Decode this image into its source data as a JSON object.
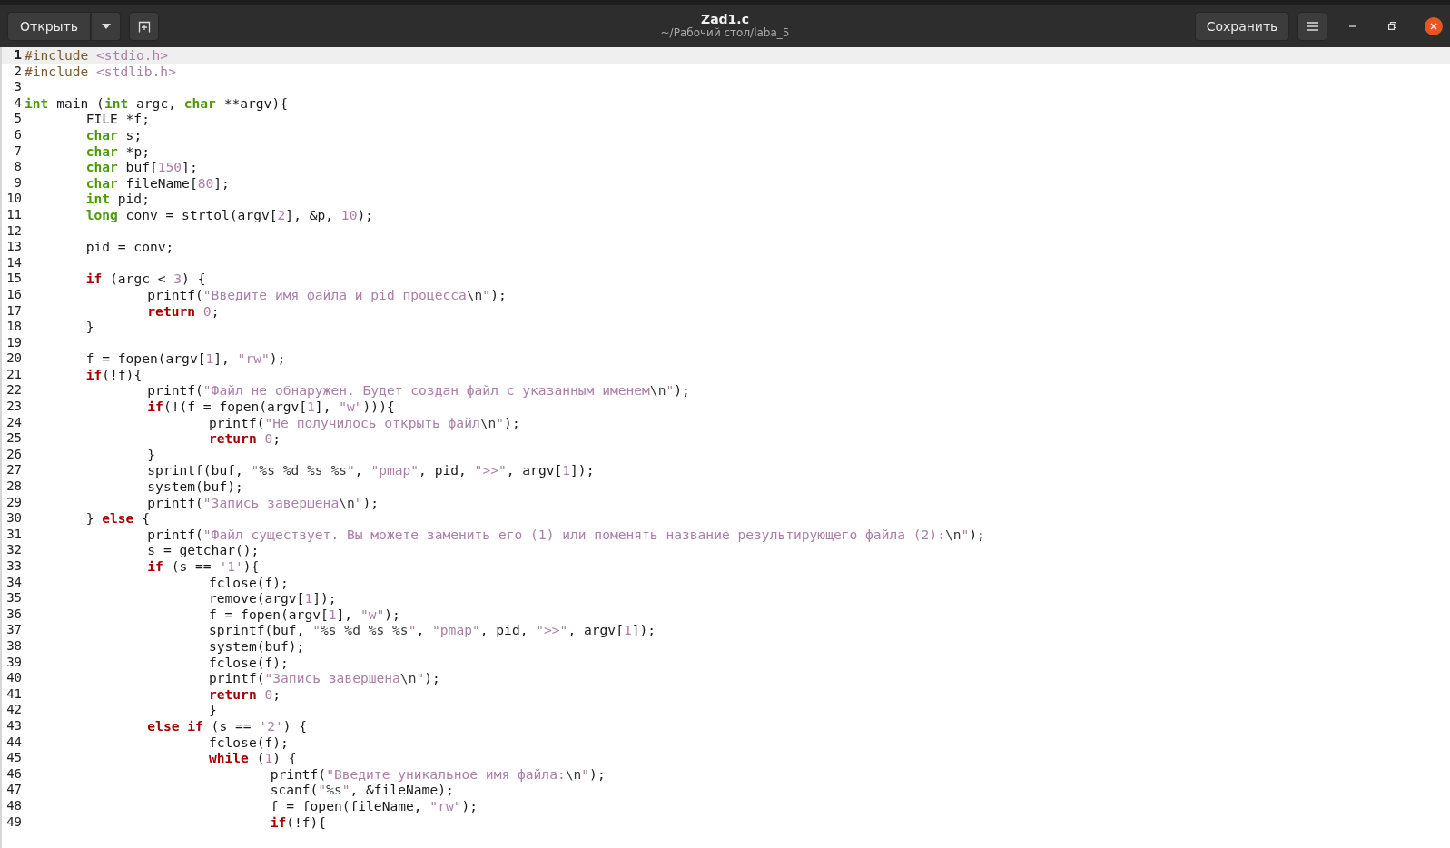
{
  "window": {
    "title": "Zad1.c",
    "subtitle": "~/Рабочий стол/laba_5"
  },
  "header": {
    "open_button": "Открыть",
    "save_button": "Сохранить"
  },
  "lines": [
    {
      "number": "1",
      "current": true,
      "tokens": [
        {
          "kind": "directive",
          "text": "#include "
        },
        {
          "kind": "string",
          "text": "<stdio.h>"
        }
      ]
    },
    {
      "number": "2",
      "current": false,
      "tokens": [
        {
          "kind": "directive",
          "text": "#include "
        },
        {
          "kind": "string",
          "text": "<stdlib.h>"
        }
      ]
    },
    {
      "number": "3",
      "current": false
    },
    {
      "number": "4",
      "current": false,
      "tokens": [
        {
          "kind": "type",
          "text": "int"
        },
        {
          "kind": "plain",
          "text": " main ("
        },
        {
          "kind": "type",
          "text": "int"
        },
        {
          "kind": "plain",
          "text": " argc, "
        },
        {
          "kind": "type",
          "text": "char"
        },
        {
          "kind": "plain",
          "text": " **argv){"
        }
      ]
    },
    {
      "number": "5",
      "current": false,
      "tokens": [
        {
          "kind": "plain",
          "text": "\tFILE *f;"
        }
      ]
    },
    {
      "number": "6",
      "current": false,
      "tokens": [
        {
          "kind": "type",
          "text": "\tchar"
        },
        {
          "kind": "plain",
          "text": " s;"
        }
      ]
    },
    {
      "number": "7",
      "current": false,
      "tokens": [
        {
          "kind": "type",
          "text": "\tchar"
        },
        {
          "kind": "plain",
          "text": " *p;"
        }
      ]
    },
    {
      "number": "8",
      "current": false,
      "tokens": [
        {
          "kind": "type",
          "text": "\tchar"
        },
        {
          "kind": "plain",
          "text": " buf["
        },
        {
          "kind": "number",
          "text": "150"
        },
        {
          "kind": "plain",
          "text": "];"
        }
      ]
    },
    {
      "number": "9",
      "current": false,
      "tokens": [
        {
          "kind": "type",
          "text": "\tchar"
        },
        {
          "kind": "plain",
          "text": " fileName["
        },
        {
          "kind": "number",
          "text": "80"
        },
        {
          "kind": "plain",
          "text": "];"
        }
      ]
    },
    {
      "number": "10",
      "current": false,
      "tokens": [
        {
          "kind": "type",
          "text": "\tint"
        },
        {
          "kind": "plain",
          "text": " pid;"
        }
      ]
    },
    {
      "number": "11",
      "current": false,
      "tokens": [
        {
          "kind": "type",
          "text": "\tlong"
        },
        {
          "kind": "plain",
          "text": " conv = strtol(argv["
        },
        {
          "kind": "number",
          "text": "2"
        },
        {
          "kind": "plain",
          "text": "], &p, "
        },
        {
          "kind": "number",
          "text": "10"
        },
        {
          "kind": "plain",
          "text": ");"
        }
      ]
    },
    {
      "number": "12",
      "current": false
    },
    {
      "number": "13",
      "current": false,
      "tokens": [
        {
          "kind": "plain",
          "text": "\tpid = conv;"
        }
      ]
    },
    {
      "number": "14",
      "current": false
    },
    {
      "number": "15",
      "current": false,
      "tokens": [
        {
          "kind": "keyword",
          "text": "\tif"
        },
        {
          "kind": "plain",
          "text": " (argc < "
        },
        {
          "kind": "number",
          "text": "3"
        },
        {
          "kind": "plain",
          "text": ") {"
        }
      ]
    },
    {
      "number": "16",
      "current": false,
      "tokens": [
        {
          "kind": "plain",
          "text": "\t\tprintf("
        },
        {
          "kind": "string",
          "text": "\"Введите имя файла и pid процесса"
        },
        {
          "kind": "escape",
          "text": "\\n"
        },
        {
          "kind": "string",
          "text": "\""
        },
        {
          "kind": "plain",
          "text": ");"
        }
      ]
    },
    {
      "number": "17",
      "current": false,
      "tokens": [
        {
          "kind": "keyword",
          "text": "\t\treturn "
        },
        {
          "kind": "number",
          "text": "0"
        },
        {
          "kind": "plain",
          "text": ";"
        }
      ]
    },
    {
      "number": "18",
      "current": false,
      "tokens": [
        {
          "kind": "plain",
          "text": "\t}"
        }
      ]
    },
    {
      "number": "19",
      "current": false
    },
    {
      "number": "20",
      "current": false,
      "tokens": [
        {
          "kind": "plain",
          "text": "\tf = fopen(argv["
        },
        {
          "kind": "number",
          "text": "1"
        },
        {
          "kind": "plain",
          "text": "], "
        },
        {
          "kind": "string",
          "text": "\"rw\""
        },
        {
          "kind": "plain",
          "text": ");"
        }
      ]
    },
    {
      "number": "21",
      "current": false,
      "tokens": [
        {
          "kind": "keyword",
          "text": "\tif"
        },
        {
          "kind": "plain",
          "text": "(!f){"
        }
      ]
    },
    {
      "number": "22",
      "current": false,
      "tokens": [
        {
          "kind": "plain",
          "text": "\t\tprintf("
        },
        {
          "kind": "string",
          "text": "\"Файл не обнаружен. Будет создан файл с указанным именем"
        },
        {
          "kind": "escape",
          "text": "\\n"
        },
        {
          "kind": "string",
          "text": "\""
        },
        {
          "kind": "plain",
          "text": ");"
        }
      ]
    },
    {
      "number": "23",
      "current": false,
      "tokens": [
        {
          "kind": "keyword",
          "text": "\t\tif"
        },
        {
          "kind": "plain",
          "text": "(!(f = fopen(argv["
        },
        {
          "kind": "number",
          "text": "1"
        },
        {
          "kind": "plain",
          "text": "], "
        },
        {
          "kind": "string",
          "text": "\"w\""
        },
        {
          "kind": "plain",
          "text": "))){"
        }
      ]
    },
    {
      "number": "24",
      "current": false,
      "tokens": [
        {
          "kind": "plain",
          "text": "\t\t\tprintf("
        },
        {
          "kind": "string",
          "text": "\"Не получилось открыть файл"
        },
        {
          "kind": "escape",
          "text": "\\n"
        },
        {
          "kind": "string",
          "text": "\""
        },
        {
          "kind": "plain",
          "text": ");"
        }
      ]
    },
    {
      "number": "25",
      "current": false,
      "tokens": [
        {
          "kind": "keyword",
          "text": "\t\t\treturn "
        },
        {
          "kind": "number",
          "text": "0"
        },
        {
          "kind": "plain",
          "text": ";"
        }
      ]
    },
    {
      "number": "26",
      "current": false,
      "tokens": [
        {
          "kind": "plain",
          "text": "\t\t}"
        }
      ]
    },
    {
      "number": "27",
      "current": false,
      "tokens": [
        {
          "kind": "plain",
          "text": "\t\tsprintf(buf, "
        },
        {
          "kind": "string",
          "text": "\""
        },
        {
          "kind": "escape",
          "text": "%s %d %s %s"
        },
        {
          "kind": "string",
          "text": "\""
        },
        {
          "kind": "plain",
          "text": ", "
        },
        {
          "kind": "string",
          "text": "\"pmap\""
        },
        {
          "kind": "plain",
          "text": ", pid, "
        },
        {
          "kind": "string",
          "text": "\">>\""
        },
        {
          "kind": "plain",
          "text": ", argv["
        },
        {
          "kind": "number",
          "text": "1"
        },
        {
          "kind": "plain",
          "text": "]);"
        }
      ]
    },
    {
      "number": "28",
      "current": false,
      "tokens": [
        {
          "kind": "plain",
          "text": "\t\tsystem(buf);"
        }
      ]
    },
    {
      "number": "29",
      "current": false,
      "tokens": [
        {
          "kind": "plain",
          "text": "\t\tprintf("
        },
        {
          "kind": "string",
          "text": "\"Запись завершена"
        },
        {
          "kind": "escape",
          "text": "\\n"
        },
        {
          "kind": "string",
          "text": "\""
        },
        {
          "kind": "plain",
          "text": ");"
        }
      ]
    },
    {
      "number": "30",
      "current": false,
      "tokens": [
        {
          "kind": "plain",
          "text": "\t} "
        },
        {
          "kind": "keyword",
          "text": "else"
        },
        {
          "kind": "plain",
          "text": " {"
        }
      ]
    },
    {
      "number": "31",
      "current": false,
      "tokens": [
        {
          "kind": "plain",
          "text": "\t\tprintf("
        },
        {
          "kind": "string",
          "text": "\"Файл существует. Вы можете заменить его (1) или поменять название результирующего файла (2):"
        },
        {
          "kind": "escape",
          "text": "\\n"
        },
        {
          "kind": "string",
          "text": "\""
        },
        {
          "kind": "plain",
          "text": ");"
        }
      ]
    },
    {
      "number": "32",
      "current": false,
      "tokens": [
        {
          "kind": "plain",
          "text": "\t\ts = getchar();"
        }
      ]
    },
    {
      "number": "33",
      "current": false,
      "tokens": [
        {
          "kind": "keyword",
          "text": "\t\tif"
        },
        {
          "kind": "plain",
          "text": " (s == "
        },
        {
          "kind": "string",
          "text": "'1'"
        },
        {
          "kind": "plain",
          "text": "){"
        }
      ]
    },
    {
      "number": "34",
      "current": false,
      "tokens": [
        {
          "kind": "plain",
          "text": "\t\t\tfclose(f);"
        }
      ]
    },
    {
      "number": "35",
      "current": false,
      "tokens": [
        {
          "kind": "plain",
          "text": "\t\t\tremove(argv["
        },
        {
          "kind": "number",
          "text": "1"
        },
        {
          "kind": "plain",
          "text": "]);"
        }
      ]
    },
    {
      "number": "36",
      "current": false,
      "tokens": [
        {
          "kind": "plain",
          "text": "\t\t\tf = fopen(argv["
        },
        {
          "kind": "number",
          "text": "1"
        },
        {
          "kind": "plain",
          "text": "], "
        },
        {
          "kind": "string",
          "text": "\"w\""
        },
        {
          "kind": "plain",
          "text": ");"
        }
      ]
    },
    {
      "number": "37",
      "current": false,
      "tokens": [
        {
          "kind": "plain",
          "text": "\t\t\tsprintf(buf, "
        },
        {
          "kind": "string",
          "text": "\""
        },
        {
          "kind": "escape",
          "text": "%s %d %s %s"
        },
        {
          "kind": "string",
          "text": "\""
        },
        {
          "kind": "plain",
          "text": ", "
        },
        {
          "kind": "string",
          "text": "\"pmap\""
        },
        {
          "kind": "plain",
          "text": ", pid, "
        },
        {
          "kind": "string",
          "text": "\">>\""
        },
        {
          "kind": "plain",
          "text": ", argv["
        },
        {
          "kind": "number",
          "text": "1"
        },
        {
          "kind": "plain",
          "text": "]);"
        }
      ]
    },
    {
      "number": "38",
      "current": false,
      "tokens": [
        {
          "kind": "plain",
          "text": "\t\t\tsystem(buf);"
        }
      ]
    },
    {
      "number": "39",
      "current": false,
      "tokens": [
        {
          "kind": "plain",
          "text": "\t\t\tfclose(f);"
        }
      ]
    },
    {
      "number": "40",
      "current": false,
      "tokens": [
        {
          "kind": "plain",
          "text": "\t\t\tprintf("
        },
        {
          "kind": "string",
          "text": "\"Запись завершена"
        },
        {
          "kind": "escape",
          "text": "\\n"
        },
        {
          "kind": "string",
          "text": "\""
        },
        {
          "kind": "plain",
          "text": ");"
        }
      ]
    },
    {
      "number": "41",
      "current": false,
      "tokens": [
        {
          "kind": "keyword",
          "text": "\t\t\treturn "
        },
        {
          "kind": "number",
          "text": "0"
        },
        {
          "kind": "plain",
          "text": ";"
        }
      ]
    },
    {
      "number": "42",
      "current": false,
      "tokens": [
        {
          "kind": "plain",
          "text": "\t\t\t}"
        }
      ]
    },
    {
      "number": "43",
      "current": false,
      "tokens": [
        {
          "kind": "keyword",
          "text": "\t\telse if"
        },
        {
          "kind": "plain",
          "text": " (s == "
        },
        {
          "kind": "string",
          "text": "'2'"
        },
        {
          "kind": "plain",
          "text": ") {"
        }
      ]
    },
    {
      "number": "44",
      "current": false,
      "tokens": [
        {
          "kind": "plain",
          "text": "\t\t\tfclose(f);"
        }
      ]
    },
    {
      "number": "45",
      "current": false,
      "tokens": [
        {
          "kind": "keyword",
          "text": "\t\t\twhile"
        },
        {
          "kind": "plain",
          "text": " ("
        },
        {
          "kind": "number",
          "text": "1"
        },
        {
          "kind": "plain",
          "text": ") {"
        }
      ]
    },
    {
      "number": "46",
      "current": false,
      "tokens": [
        {
          "kind": "plain",
          "text": "\t\t\t\tprintf("
        },
        {
          "kind": "string",
          "text": "\"Введите уникальное имя файла:"
        },
        {
          "kind": "escape",
          "text": "\\n"
        },
        {
          "kind": "string",
          "text": "\""
        },
        {
          "kind": "plain",
          "text": ");"
        }
      ]
    },
    {
      "number": "47",
      "current": false,
      "tokens": [
        {
          "kind": "plain",
          "text": "\t\t\t\tscanf("
        },
        {
          "kind": "string",
          "text": "\""
        },
        {
          "kind": "escape",
          "text": "%s"
        },
        {
          "kind": "string",
          "text": "\""
        },
        {
          "kind": "plain",
          "text": ", &fileName);"
        }
      ]
    },
    {
      "number": "48",
      "current": false,
      "tokens": [
        {
          "kind": "plain",
          "text": "\t\t\t\tf = fopen(fileName, "
        },
        {
          "kind": "string",
          "text": "\"rw\""
        },
        {
          "kind": "plain",
          "text": ");"
        }
      ]
    },
    {
      "number": "49",
      "current": false,
      "tokens": [
        {
          "kind": "keyword",
          "text": "\t\t\t\tif"
        },
        {
          "kind": "plain",
          "text": "(!f){"
        }
      ]
    }
  ]
}
